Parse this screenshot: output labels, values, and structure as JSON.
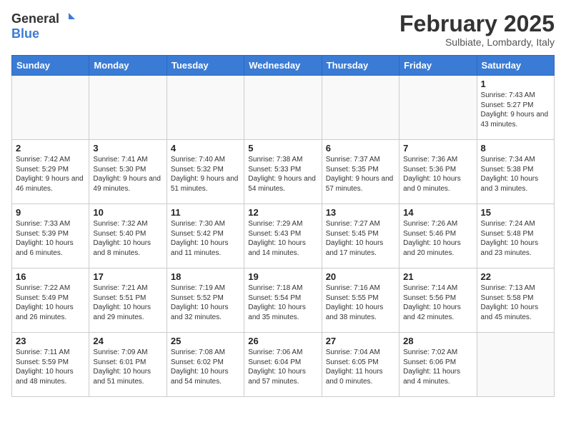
{
  "header": {
    "logo_general": "General",
    "logo_blue": "Blue",
    "month_title": "February 2025",
    "subtitle": "Sulbiate, Lombardy, Italy"
  },
  "weekdays": [
    "Sunday",
    "Monday",
    "Tuesday",
    "Wednesday",
    "Thursday",
    "Friday",
    "Saturday"
  ],
  "weeks": [
    [
      {
        "day": "",
        "info": ""
      },
      {
        "day": "",
        "info": ""
      },
      {
        "day": "",
        "info": ""
      },
      {
        "day": "",
        "info": ""
      },
      {
        "day": "",
        "info": ""
      },
      {
        "day": "",
        "info": ""
      },
      {
        "day": "1",
        "info": "Sunrise: 7:43 AM\nSunset: 5:27 PM\nDaylight: 9 hours\nand 43 minutes."
      }
    ],
    [
      {
        "day": "2",
        "info": "Sunrise: 7:42 AM\nSunset: 5:29 PM\nDaylight: 9 hours\nand 46 minutes."
      },
      {
        "day": "3",
        "info": "Sunrise: 7:41 AM\nSunset: 5:30 PM\nDaylight: 9 hours\nand 49 minutes."
      },
      {
        "day": "4",
        "info": "Sunrise: 7:40 AM\nSunset: 5:32 PM\nDaylight: 9 hours\nand 51 minutes."
      },
      {
        "day": "5",
        "info": "Sunrise: 7:38 AM\nSunset: 5:33 PM\nDaylight: 9 hours\nand 54 minutes."
      },
      {
        "day": "6",
        "info": "Sunrise: 7:37 AM\nSunset: 5:35 PM\nDaylight: 9 hours\nand 57 minutes."
      },
      {
        "day": "7",
        "info": "Sunrise: 7:36 AM\nSunset: 5:36 PM\nDaylight: 10 hours\nand 0 minutes."
      },
      {
        "day": "8",
        "info": "Sunrise: 7:34 AM\nSunset: 5:38 PM\nDaylight: 10 hours\nand 3 minutes."
      }
    ],
    [
      {
        "day": "9",
        "info": "Sunrise: 7:33 AM\nSunset: 5:39 PM\nDaylight: 10 hours\nand 6 minutes."
      },
      {
        "day": "10",
        "info": "Sunrise: 7:32 AM\nSunset: 5:40 PM\nDaylight: 10 hours\nand 8 minutes."
      },
      {
        "day": "11",
        "info": "Sunrise: 7:30 AM\nSunset: 5:42 PM\nDaylight: 10 hours\nand 11 minutes."
      },
      {
        "day": "12",
        "info": "Sunrise: 7:29 AM\nSunset: 5:43 PM\nDaylight: 10 hours\nand 14 minutes."
      },
      {
        "day": "13",
        "info": "Sunrise: 7:27 AM\nSunset: 5:45 PM\nDaylight: 10 hours\nand 17 minutes."
      },
      {
        "day": "14",
        "info": "Sunrise: 7:26 AM\nSunset: 5:46 PM\nDaylight: 10 hours\nand 20 minutes."
      },
      {
        "day": "15",
        "info": "Sunrise: 7:24 AM\nSunset: 5:48 PM\nDaylight: 10 hours\nand 23 minutes."
      }
    ],
    [
      {
        "day": "16",
        "info": "Sunrise: 7:22 AM\nSunset: 5:49 PM\nDaylight: 10 hours\nand 26 minutes."
      },
      {
        "day": "17",
        "info": "Sunrise: 7:21 AM\nSunset: 5:51 PM\nDaylight: 10 hours\nand 29 minutes."
      },
      {
        "day": "18",
        "info": "Sunrise: 7:19 AM\nSunset: 5:52 PM\nDaylight: 10 hours\nand 32 minutes."
      },
      {
        "day": "19",
        "info": "Sunrise: 7:18 AM\nSunset: 5:54 PM\nDaylight: 10 hours\nand 35 minutes."
      },
      {
        "day": "20",
        "info": "Sunrise: 7:16 AM\nSunset: 5:55 PM\nDaylight: 10 hours\nand 38 minutes."
      },
      {
        "day": "21",
        "info": "Sunrise: 7:14 AM\nSunset: 5:56 PM\nDaylight: 10 hours\nand 42 minutes."
      },
      {
        "day": "22",
        "info": "Sunrise: 7:13 AM\nSunset: 5:58 PM\nDaylight: 10 hours\nand 45 minutes."
      }
    ],
    [
      {
        "day": "23",
        "info": "Sunrise: 7:11 AM\nSunset: 5:59 PM\nDaylight: 10 hours\nand 48 minutes."
      },
      {
        "day": "24",
        "info": "Sunrise: 7:09 AM\nSunset: 6:01 PM\nDaylight: 10 hours\nand 51 minutes."
      },
      {
        "day": "25",
        "info": "Sunrise: 7:08 AM\nSunset: 6:02 PM\nDaylight: 10 hours\nand 54 minutes."
      },
      {
        "day": "26",
        "info": "Sunrise: 7:06 AM\nSunset: 6:04 PM\nDaylight: 10 hours\nand 57 minutes."
      },
      {
        "day": "27",
        "info": "Sunrise: 7:04 AM\nSunset: 6:05 PM\nDaylight: 11 hours\nand 0 minutes."
      },
      {
        "day": "28",
        "info": "Sunrise: 7:02 AM\nSunset: 6:06 PM\nDaylight: 11 hours\nand 4 minutes."
      },
      {
        "day": "",
        "info": ""
      }
    ]
  ]
}
